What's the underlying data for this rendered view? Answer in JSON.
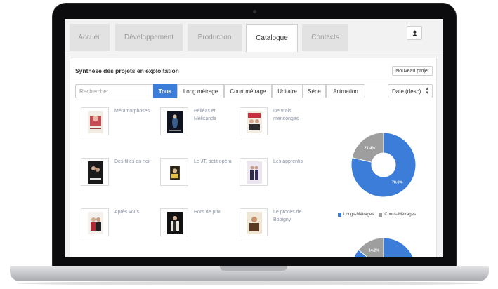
{
  "nav": {
    "tabs": [
      {
        "label": "Accueil",
        "active": false
      },
      {
        "label": "Développement",
        "active": false
      },
      {
        "label": "Production",
        "active": false
      },
      {
        "label": "Catalogue",
        "active": true
      },
      {
        "label": "Contacts",
        "active": false
      }
    ],
    "user_icon": "user-icon"
  },
  "panel": {
    "title": "Synthèse des projets en exploitation",
    "new_button": "Nouveau projet"
  },
  "search": {
    "placeholder": "Rechercher..."
  },
  "filters": [
    {
      "label": "Tous",
      "active": true
    },
    {
      "label": "Long métrage",
      "active": false
    },
    {
      "label": "Court métrage",
      "active": false
    },
    {
      "label": "Unitaire",
      "active": false
    },
    {
      "label": "Série",
      "active": false
    },
    {
      "label": "Animation",
      "active": false
    }
  ],
  "sort": {
    "label": "Date (desc)"
  },
  "projects": [
    {
      "title": "Métamorphoses"
    },
    {
      "title": "Pelléas et Mélisande"
    },
    {
      "title": "De vrais mensonges"
    },
    {
      "title": "Des filles en noir"
    },
    {
      "title": "Le JT, petit opéra"
    },
    {
      "title": "Les apprentis"
    },
    {
      "title": "Après vous"
    },
    {
      "title": "Hors de prix"
    },
    {
      "title": "Le procès de Bobigny"
    }
  ],
  "colors": {
    "accent": "#3b7dd8",
    "secondary": "#9e9e9e"
  },
  "chart_data": [
    {
      "type": "pie",
      "categories": [
        "Longs-Métrages",
        "Courts-Métrages"
      ],
      "values": [
        78.6,
        21.4
      ],
      "labels": [
        "78.6%",
        "21.4%"
      ],
      "colors": [
        "#3b7dd8",
        "#9e9e9e"
      ],
      "legend": "bottom"
    },
    {
      "type": "pie",
      "categories": [
        "Longs-Métrages",
        "Courts-Métrages"
      ],
      "values": [
        85.8,
        14.2
      ],
      "labels": [
        "",
        "14.2%"
      ],
      "colors": [
        "#3b7dd8",
        "#9e9e9e"
      ],
      "legend": "none"
    }
  ]
}
